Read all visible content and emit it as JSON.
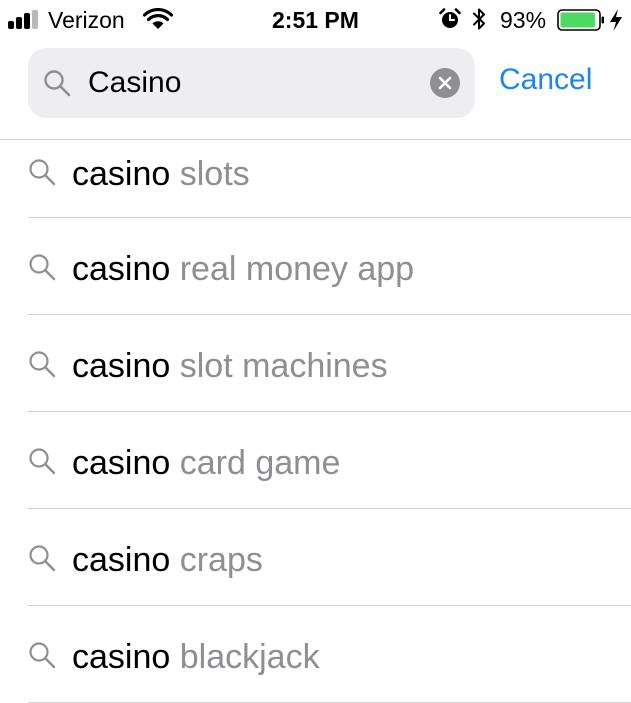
{
  "status_bar": {
    "carrier": "Verizon",
    "time": "2:51 PM",
    "battery_percent": "93%",
    "battery_level": 0.93,
    "signal_bars_active": 3,
    "signal_bars_total": 4,
    "icons": [
      "signal-icon",
      "wifi-icon",
      "alarm-icon",
      "bluetooth-icon",
      "battery-icon",
      "charging-bolt-icon"
    ]
  },
  "search": {
    "value": "Casino",
    "icon": "search-icon",
    "clear_icon": "clear-icon"
  },
  "cancel_label": "Cancel",
  "suggestions": [
    {
      "typed": "casino",
      "rest": " slots"
    },
    {
      "typed": "casino",
      "rest": " real money app"
    },
    {
      "typed": "casino",
      "rest": " slot machines"
    },
    {
      "typed": "casino",
      "rest": " card game"
    },
    {
      "typed": "casino",
      "rest": " craps"
    },
    {
      "typed": "casino",
      "rest": " blackjack"
    }
  ],
  "colors": {
    "accent": "#1a86f0",
    "battery_fill": "#4cd964",
    "muted_text": "#8e8e93",
    "field_background": "#eeeef0"
  }
}
